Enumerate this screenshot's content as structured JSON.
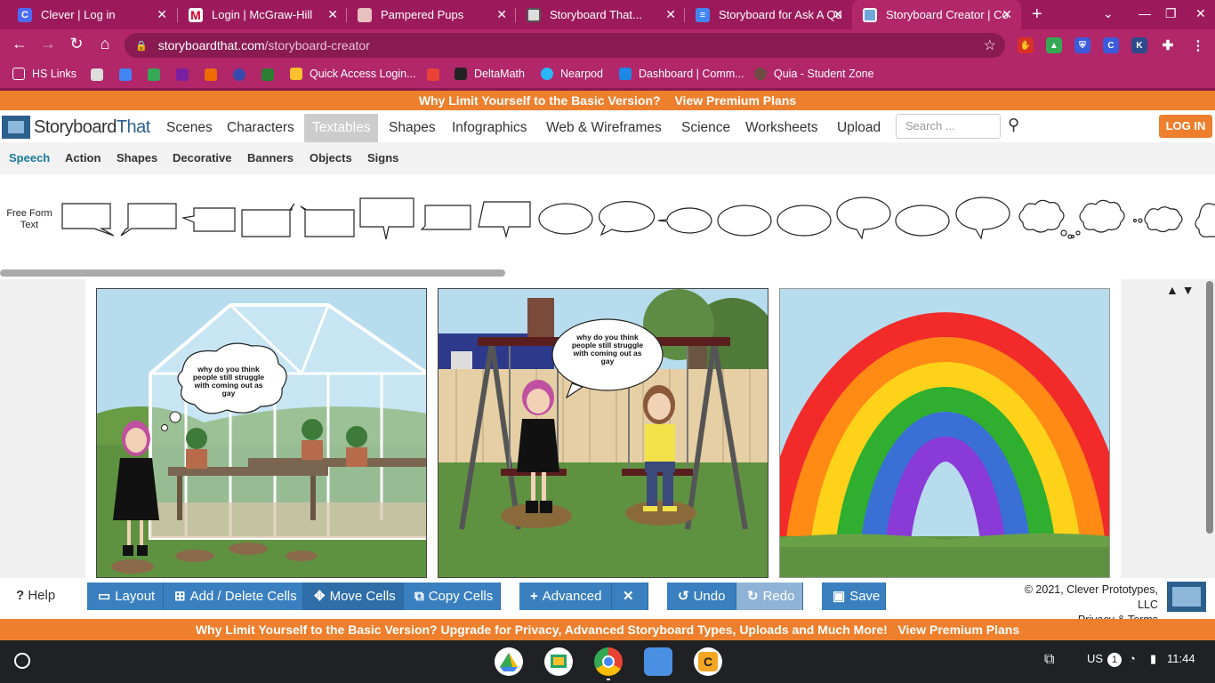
{
  "browser": {
    "tabs": [
      {
        "title": "Clever | Log in",
        "icon": "clever-icon",
        "color": "#4a6cf7",
        "letter": "C"
      },
      {
        "title": "Login | McGraw-Hill",
        "icon": "mcgraw-icon",
        "color": "#d4002a",
        "letter": "M"
      },
      {
        "title": "Pampered Pups",
        "icon": "pups-icon",
        "color": "#8a3c3c",
        "letter": ""
      },
      {
        "title": "Storyboard That...",
        "icon": "storyboard-icon",
        "color": "#444",
        "letter": ""
      },
      {
        "title": "Storyboard for Ask A Qu",
        "icon": "docs-icon",
        "color": "#4285f4",
        "letter": ""
      },
      {
        "title": "Storyboard Creator | Co",
        "icon": "storyboard-icon",
        "color": "#6fa8dc",
        "letter": ""
      }
    ],
    "url_host": "storyboardthat.com",
    "url_path": "/storyboard-creator",
    "bookmarks": [
      {
        "label": "HS Links"
      },
      {
        "label": "Quick Access Login..."
      },
      {
        "label": "DeltaMath"
      },
      {
        "label": "Nearpod"
      },
      {
        "label": "Dashboard | Comm..."
      },
      {
        "label": "Quia - Student Zone"
      }
    ]
  },
  "promo_top": {
    "text": "Why Limit Yourself to the Basic Version?",
    "link": "View Premium Plans"
  },
  "site": {
    "logo_prefix": "Storyboard",
    "logo_suffix": "That",
    "nav": [
      "Scenes",
      "Characters",
      "Textables",
      "Shapes",
      "Infographics",
      "Web & Wireframes",
      "Science",
      "Worksheets",
      "Upload"
    ],
    "search_placeholder": "Search ...",
    "login": "LOG IN",
    "subnav": [
      "Speech",
      "Action",
      "Shapes",
      "Decorative",
      "Banners",
      "Objects",
      "Signs"
    ],
    "free_form_text": "Free Form Text"
  },
  "cells": [
    {
      "bubble": "why do you think people still struggle with coming out as gay"
    },
    {
      "bubble": "why do you think people still struggle with coming out as gay"
    },
    {
      "bubble": ""
    }
  ],
  "toolbar": {
    "help": "Help",
    "layout": "Layout",
    "add_delete": "Add / Delete Cells",
    "move": "Move Cells",
    "copy": "Copy Cells",
    "advanced": "Advanced",
    "undo": "Undo",
    "redo": "Redo",
    "save": "Save",
    "copyright": "© 2021, Clever Prototypes, LLC",
    "privacy": "Privacy & Terms"
  },
  "promo_bottom": {
    "text": "Why Limit Yourself to the Basic Version? Upgrade for Privacy, Advanced Storyboard Types, Uploads and Much More!",
    "link": "View Premium Plans"
  },
  "shelf": {
    "locale": "US",
    "notif_count": "1",
    "time": "11:44"
  }
}
